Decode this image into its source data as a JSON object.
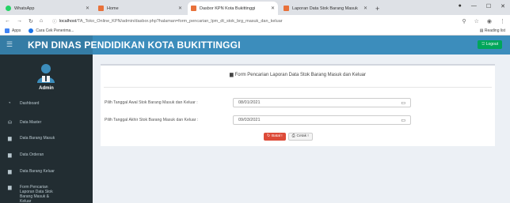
{
  "browser": {
    "tabs": [
      {
        "title": "WhatsApp",
        "color": "#25d366",
        "active": false
      },
      {
        "title": "Home",
        "color": "#e8713a",
        "active": false
      },
      {
        "title": "Dasbor KPN Kota Bukittinggi",
        "color": "#e8713a",
        "active": true
      },
      {
        "title": "Laporan Data Stok Barang Masuk",
        "color": "#e8713a",
        "active": false
      }
    ],
    "url_host": "localhost",
    "url_path": "/TA_Toko_Online_KPN/admin/dasbor.php?halaman=form_pencarian_lpm_dt_stok_brg_masuk_dan_keluar",
    "bookmarks": [
      "Apps",
      "Cara Cek Penerima..."
    ],
    "reading_list": "Reading list"
  },
  "header": {
    "brand": "KPN DINAS PENDIDIKAN KOTA BUKITTINGGI",
    "logout": "Logout"
  },
  "sidebar": {
    "user": "Admin",
    "items": [
      {
        "label": "Dashboard",
        "icon": "dashboard-icon"
      },
      {
        "label": "Data Master",
        "icon": "database-icon"
      },
      {
        "label": "Data Barang Masuk",
        "icon": "file-icon"
      },
      {
        "label": "Data Orderan",
        "icon": "file-icon"
      },
      {
        "label": "Data Barang Keluar",
        "icon": "file-icon"
      },
      {
        "label": "Form Pencarian Laporan Data Stok Barang Masuk & Keluar",
        "icon": "file-icon"
      }
    ]
  },
  "form": {
    "title": "Form Pencarian Laporan Data Stok Barang Masuk dan Keluar",
    "start_label": "Pilih Tanggal Awal Stok Barang Masuk dan Keluar :",
    "start_value": "08/01/2021",
    "end_label": "Pilih Tanggal Akhir Stok Barang Masuk dan Keluar :",
    "end_value": "09/03/2021",
    "reset_label": "Batal !",
    "print_label": "Cetak !"
  }
}
